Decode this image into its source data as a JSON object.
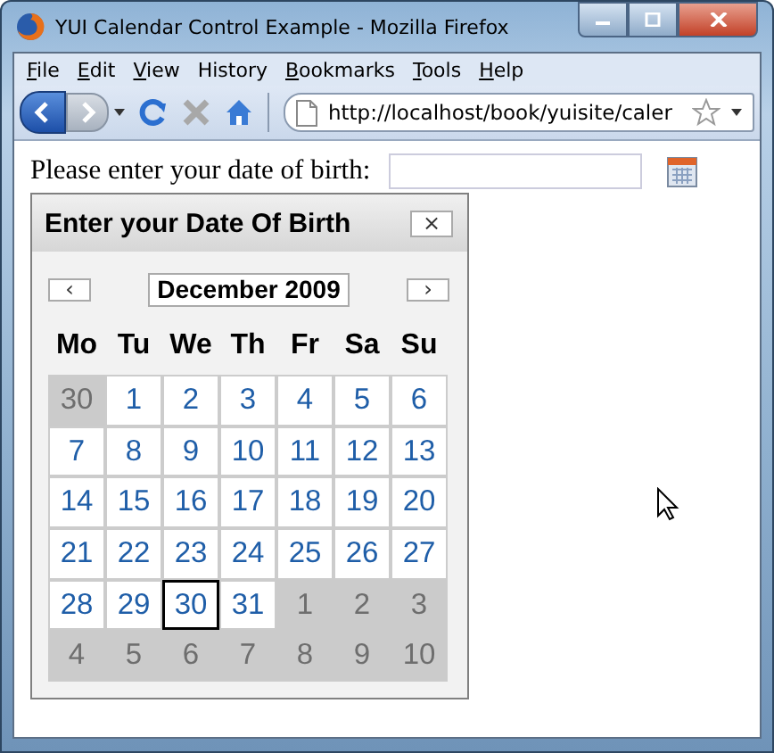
{
  "window": {
    "title": "YUI Calendar Control Example - Mozilla Firefox"
  },
  "menu": [
    {
      "label": "File",
      "underline_first": true
    },
    {
      "label": "Edit",
      "underline_first": true
    },
    {
      "label": "View",
      "underline_first": true
    },
    {
      "label": "History",
      "underline_first": false
    },
    {
      "label": "Bookmarks",
      "underline_first": true
    },
    {
      "label": "Tools",
      "underline_first": true
    },
    {
      "label": "Help",
      "underline_first": true
    }
  ],
  "address": {
    "value": "http://localhost/book/yuisite/caler"
  },
  "form": {
    "label": "Please enter your date of birth:"
  },
  "calendar": {
    "title": "Enter your Date Of Birth",
    "close": "×",
    "prev": "‹",
    "next": "›",
    "month": "December 2009",
    "weekdays": [
      "Mo",
      "Tu",
      "We",
      "Th",
      "Fr",
      "Sa",
      "Su"
    ],
    "days": [
      {
        "label": "30",
        "outside": true,
        "today": false
      },
      {
        "label": "1",
        "outside": false,
        "today": false
      },
      {
        "label": "2",
        "outside": false,
        "today": false
      },
      {
        "label": "3",
        "outside": false,
        "today": false
      },
      {
        "label": "4",
        "outside": false,
        "today": false
      },
      {
        "label": "5",
        "outside": false,
        "today": false
      },
      {
        "label": "6",
        "outside": false,
        "today": false
      },
      {
        "label": "7",
        "outside": false,
        "today": false
      },
      {
        "label": "8",
        "outside": false,
        "today": false
      },
      {
        "label": "9",
        "outside": false,
        "today": false
      },
      {
        "label": "10",
        "outside": false,
        "today": false
      },
      {
        "label": "11",
        "outside": false,
        "today": false
      },
      {
        "label": "12",
        "outside": false,
        "today": false
      },
      {
        "label": "13",
        "outside": false,
        "today": false
      },
      {
        "label": "14",
        "outside": false,
        "today": false
      },
      {
        "label": "15",
        "outside": false,
        "today": false
      },
      {
        "label": "16",
        "outside": false,
        "today": false
      },
      {
        "label": "17",
        "outside": false,
        "today": false
      },
      {
        "label": "18",
        "outside": false,
        "today": false
      },
      {
        "label": "19",
        "outside": false,
        "today": false
      },
      {
        "label": "20",
        "outside": false,
        "today": false
      },
      {
        "label": "21",
        "outside": false,
        "today": false
      },
      {
        "label": "22",
        "outside": false,
        "today": false
      },
      {
        "label": "23",
        "outside": false,
        "today": false
      },
      {
        "label": "24",
        "outside": false,
        "today": false
      },
      {
        "label": "25",
        "outside": false,
        "today": false
      },
      {
        "label": "26",
        "outside": false,
        "today": false
      },
      {
        "label": "27",
        "outside": false,
        "today": false
      },
      {
        "label": "28",
        "outside": false,
        "today": false
      },
      {
        "label": "29",
        "outside": false,
        "today": false
      },
      {
        "label": "30",
        "outside": false,
        "today": true
      },
      {
        "label": "31",
        "outside": false,
        "today": false
      },
      {
        "label": "1",
        "outside": true,
        "today": false
      },
      {
        "label": "2",
        "outside": true,
        "today": false
      },
      {
        "label": "3",
        "outside": true,
        "today": false
      },
      {
        "label": "4",
        "outside": true,
        "today": false
      },
      {
        "label": "5",
        "outside": true,
        "today": false
      },
      {
        "label": "6",
        "outside": true,
        "today": false
      },
      {
        "label": "7",
        "outside": true,
        "today": false
      },
      {
        "label": "8",
        "outside": true,
        "today": false
      },
      {
        "label": "9",
        "outside": true,
        "today": false
      },
      {
        "label": "10",
        "outside": true,
        "today": false
      }
    ]
  }
}
